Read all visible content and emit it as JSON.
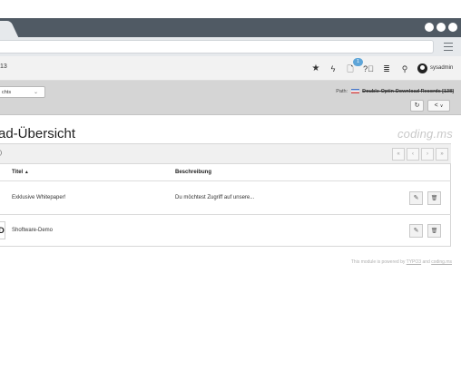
{
  "topbar": {
    "version": "13",
    "notifications_count": "1",
    "username": "sysadmin"
  },
  "docheader": {
    "function_select": "chts",
    "path_label": "Path:",
    "path_value": "Double-Optin-Download Records [138]",
    "refresh_icon": "↻",
    "share_icon": "<",
    "share_chevron": "∨"
  },
  "content": {
    "heading": "ad-Übersicht",
    "logo_text": "coding.ms",
    "panel_count": ")",
    "pager": [
      "«",
      "‹",
      "›",
      "»"
    ],
    "columns": {
      "title": "Titel",
      "sort_arrow": "▲",
      "description": "Beschreibung"
    },
    "rows": [
      {
        "title": "Exklusive Whitepaper!",
        "description": "Du möchtest Zugriff auf unsere...",
        "thumb": ""
      },
      {
        "title": "Shoftware-Demo",
        "description": "",
        "thumb": "D"
      }
    ],
    "edit_icon": "✎",
    "delete_icon": "🗑"
  },
  "footer": {
    "prefix": "This module is powered by",
    "link1": "TYPO3",
    "middle": "and",
    "link2": "coding.ms"
  },
  "colors": {
    "titlebar": "#505a64",
    "docheader": "#d5d5d5",
    "badge": "#5ea5d8"
  }
}
